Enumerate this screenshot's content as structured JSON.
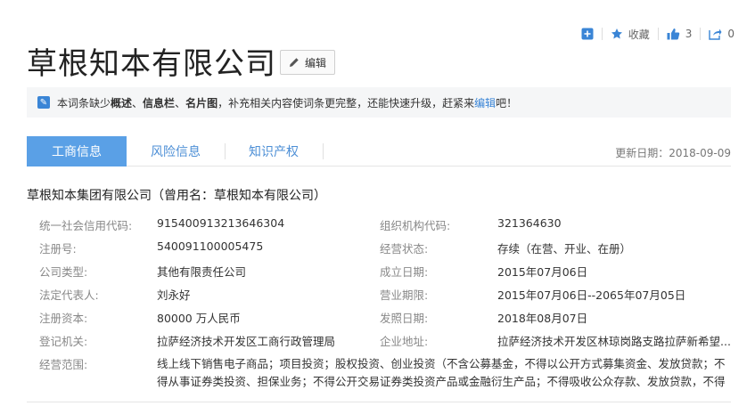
{
  "topbar": {
    "favorite_label": "收藏",
    "like_count": "3",
    "share_count": "0"
  },
  "title": "草根知本有限公司",
  "edit_label": "编辑",
  "notice": {
    "prefix": "本词条缺少",
    "b1": "概述",
    "sep1": "、",
    "b2": "信息栏",
    "sep2": "、",
    "b3": "名片图",
    "middle": "，补充相关内容使词条更完整，还能快速升级，赶紧来",
    "link": "编辑",
    "suffix": "吧！"
  },
  "tabs": [
    {
      "label": "工商信息"
    },
    {
      "label": "风险信息"
    },
    {
      "label": "知识产权"
    }
  ],
  "updated": "更新日期：2018-09-09",
  "company_name": "草根知本集团有限公司（曾用名：草根知本有限公司）",
  "fields": {
    "credit_code_label": "统一社会信用代码:",
    "credit_code": "915400913213646304",
    "org_code_label": "组织机构代码:",
    "org_code": "321364630",
    "reg_no_label": "注册号:",
    "reg_no": "540091100005475",
    "status_label": "经营状态:",
    "status": "存续（在营、开业、在册）",
    "type_label": "公司类型:",
    "type": "其他有限责任公司",
    "founded_label": "成立日期:",
    "founded": "2015年07月06日",
    "rep_label": "法定代表人:",
    "rep": "刘永好",
    "term_label": "营业期限:",
    "term": "2015年07月06日--2065年07月05日",
    "capital_label": "注册资本:",
    "capital": "80000 万人民币",
    "issued_label": "发照日期:",
    "issued": "2018年08月07日",
    "authority_label": "登记机关:",
    "authority": "拉萨经济技术开发区工商行政管理局",
    "address_label": "企业地址:",
    "address": "拉萨经济技术开发区林琼岗路支路拉萨新希望...",
    "scope_label": "经营范围:",
    "scope": "线上线下销售电子商品；项目投资；股权投资、创业投资（不含公募基金，不得以公开方式募集资金、发放贷款；不得从事证券类投资、担保业务；不得公开交易证券类投资产品或金融衍生产品；不得吸收公众存款、发放贷款，不得经营金..."
  },
  "colors": {
    "accent": "#3a85d6",
    "tab_active": "#5aa0e6"
  }
}
